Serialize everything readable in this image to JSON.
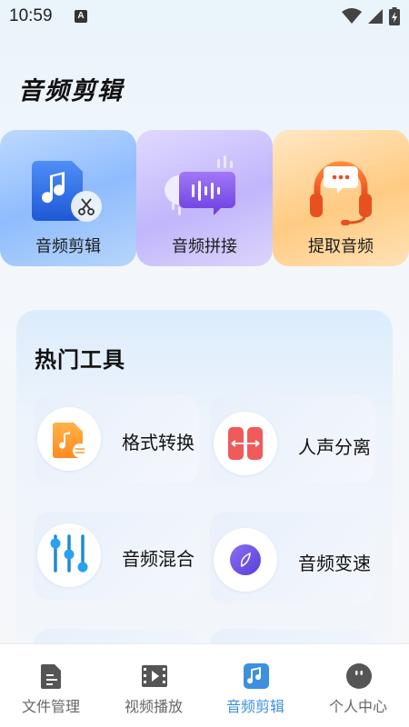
{
  "status_bar": {
    "time": "10:59",
    "notification_letter": "A",
    "icons": [
      "wifi-icon",
      "signal-icon",
      "battery-charging-icon"
    ]
  },
  "page": {
    "title": "音频剪辑"
  },
  "feature_cards": [
    {
      "label": "音频剪辑",
      "icon": "music-scissors-icon"
    },
    {
      "label": "音频拼接",
      "icon": "audio-merge-icon"
    },
    {
      "label": "提取音频",
      "icon": "headphones-icon"
    }
  ],
  "hot_tools": {
    "title": "热门工具",
    "items": [
      {
        "label": "格式转换",
        "icon": "format-convert-icon"
      },
      {
        "label": "人声分离",
        "icon": "vocal-separate-icon"
      },
      {
        "label": "音频混合",
        "icon": "audio-mix-icon"
      },
      {
        "label": "音频变速",
        "icon": "speed-change-icon"
      },
      {
        "label": "",
        "icon": ""
      },
      {
        "label": "",
        "icon": ""
      }
    ]
  },
  "bottom_nav": {
    "items": [
      {
        "label": "文件管理",
        "icon": "file-icon"
      },
      {
        "label": "视频播放",
        "icon": "film-icon"
      },
      {
        "label": "音频剪辑",
        "icon": "music-note-icon",
        "active": true
      },
      {
        "label": "个人中心",
        "icon": "person-icon"
      }
    ],
    "active_color": "#3d8fe0",
    "inactive_color": "#666666"
  }
}
